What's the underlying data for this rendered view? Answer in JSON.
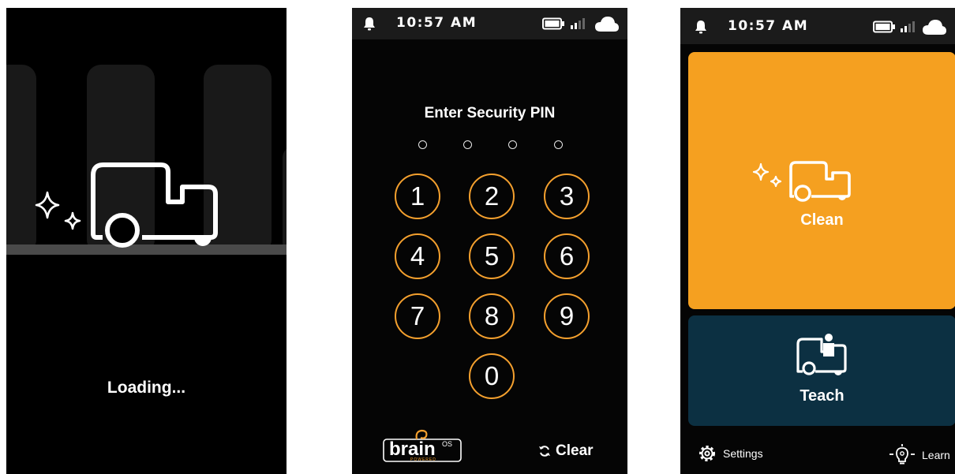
{
  "loading_screen": {
    "status_text": "Loading..."
  },
  "pin_screen": {
    "status_bar": {
      "time": "10:57 AM",
      "icons": [
        "bell-icon",
        "battery-icon",
        "signal-icon",
        "cloud-icon"
      ]
    },
    "title": "Enter Security PIN",
    "pin_length": 4,
    "keys": [
      "1",
      "2",
      "3",
      "4",
      "5",
      "6",
      "7",
      "8",
      "9",
      "0"
    ],
    "brand_logo_text": "brain",
    "brand_logo_superscript": "OS",
    "brand_logo_subtext": "POWERED",
    "clear_label": "Clear",
    "clear_icon": "refresh-icon",
    "accent_color": "#f4a02e"
  },
  "home_screen": {
    "status_bar": {
      "time": "10:57 AM",
      "icons": [
        "bell-icon",
        "battery-icon",
        "signal-icon",
        "cloud-icon"
      ]
    },
    "clean_label": "Clean",
    "clean_color": "#f5a020",
    "teach_label": "Teach",
    "teach_color": "#0c3042",
    "settings_label": "Settings",
    "learn_label": "Learn"
  }
}
